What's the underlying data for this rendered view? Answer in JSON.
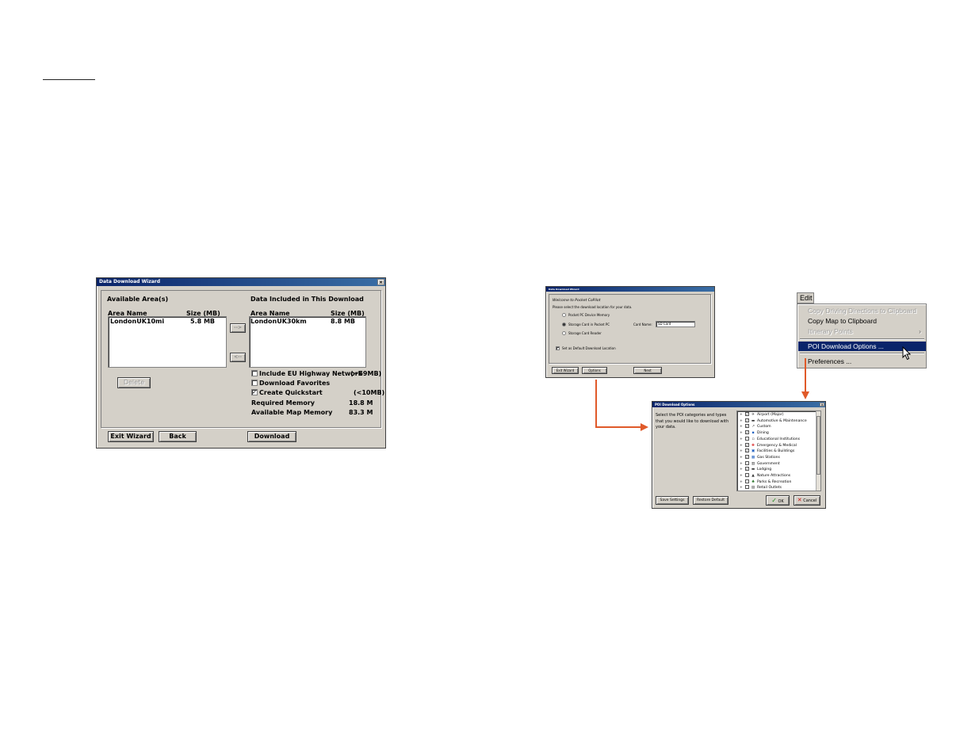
{
  "wizard": {
    "title": "Data Download Wizard",
    "close": "×",
    "available_heading": "Available Area(s)",
    "included_heading": "Data Included in This Download",
    "col_area": "Area Name",
    "col_size": "Size (MB)",
    "available_rows": [
      {
        "name": "LondonUK10mi",
        "size": "5.8 MB"
      }
    ],
    "included_rows": [
      {
        "name": "LondonUK30km",
        "size": "8.8 MB"
      }
    ],
    "add_btn": "-->",
    "remove_btn": "<--",
    "delete_btn": "Delete",
    "opt_highway": "Include EU Highway Network",
    "opt_highway_size": "(~59MB)",
    "opt_favorites": "Download Favorites",
    "opt_quickstart": "Create Quickstart",
    "opt_quickstart_size": "(<10MB)",
    "highway_checked": false,
    "favorites_checked": false,
    "quickstart_checked": true,
    "required_label": "Required Memory",
    "required_value": "18.8 M",
    "available_label": "Available Map Memory",
    "available_value": "83.3 M",
    "exit_btn": "Exit Wizard",
    "back_btn": "Back",
    "download_btn": "Download"
  },
  "location_wizard": {
    "title": "Data Download Wizard",
    "heading": "Welcome to Pocket CoPilot",
    "prompt": "Please select the download location for your data.",
    "opt1": "Pocket PC Device Memory",
    "opt2": "Storage Card in Pocket PC",
    "opt3": "Storage Card Reader",
    "card_label": "Card Name:",
    "card_value": "SD Card",
    "default_opt": "Set as Default Download Location",
    "exit_btn": "Exit Wizard",
    "options_btn": "Options",
    "next_btn": "Next"
  },
  "edit_menu": {
    "menu_title": "Edit",
    "items": [
      {
        "label": "Copy Driving Directions to Clipboard",
        "disabled": true
      },
      {
        "label": "Copy Map to Clipboard",
        "disabled": false
      },
      {
        "label": "Itinerary Points",
        "disabled": true,
        "submenu": "›"
      },
      {
        "label": "POI Download Options ...",
        "disabled": false,
        "highlighted": true
      },
      {
        "label": "Preferences ...",
        "disabled": false
      }
    ]
  },
  "poi_dialog": {
    "title": "POI Download Options",
    "close": "×",
    "description": "Select the POI categories and types that you would like to download with your data.",
    "categories": [
      {
        "label": "Airport (Major)",
        "checked": true,
        "icon": "plane-icon"
      },
      {
        "label": "Automotive & Maintenance",
        "checked": true,
        "icon": "car-icon"
      },
      {
        "label": "Custom",
        "checked": true,
        "icon": "custom-icon"
      },
      {
        "label": "Dining",
        "checked": true,
        "icon": "dining-icon"
      },
      {
        "label": "Educational Institutions",
        "checked": false,
        "icon": "school-icon"
      },
      {
        "label": "Emergency & Medical",
        "checked": true,
        "icon": "medical-icon"
      },
      {
        "label": "Facilities & Buildings",
        "checked": true,
        "icon": "building-icon"
      },
      {
        "label": "Gas Stations",
        "checked": true,
        "icon": "gas-icon"
      },
      {
        "label": "Government",
        "checked": false,
        "icon": "government-icon"
      },
      {
        "label": "Lodging",
        "checked": true,
        "icon": "bed-icon"
      },
      {
        "label": "Nature Attractions",
        "checked": false,
        "icon": "nature-icon"
      },
      {
        "label": "Parks & Recreation",
        "checked": false,
        "icon": "park-icon"
      },
      {
        "label": "Retail Outlets",
        "checked": false,
        "icon": "retail-icon"
      }
    ],
    "save_btn": "Save Settings",
    "restore_btn": "Restore Default",
    "ok_btn": "OK",
    "cancel_btn": "Cancel"
  },
  "colors": {
    "arrow": "#e05a2a",
    "titlebar": "#0a246a",
    "dialog_bg": "#d4d0c8",
    "highlight": "#0a246a"
  }
}
